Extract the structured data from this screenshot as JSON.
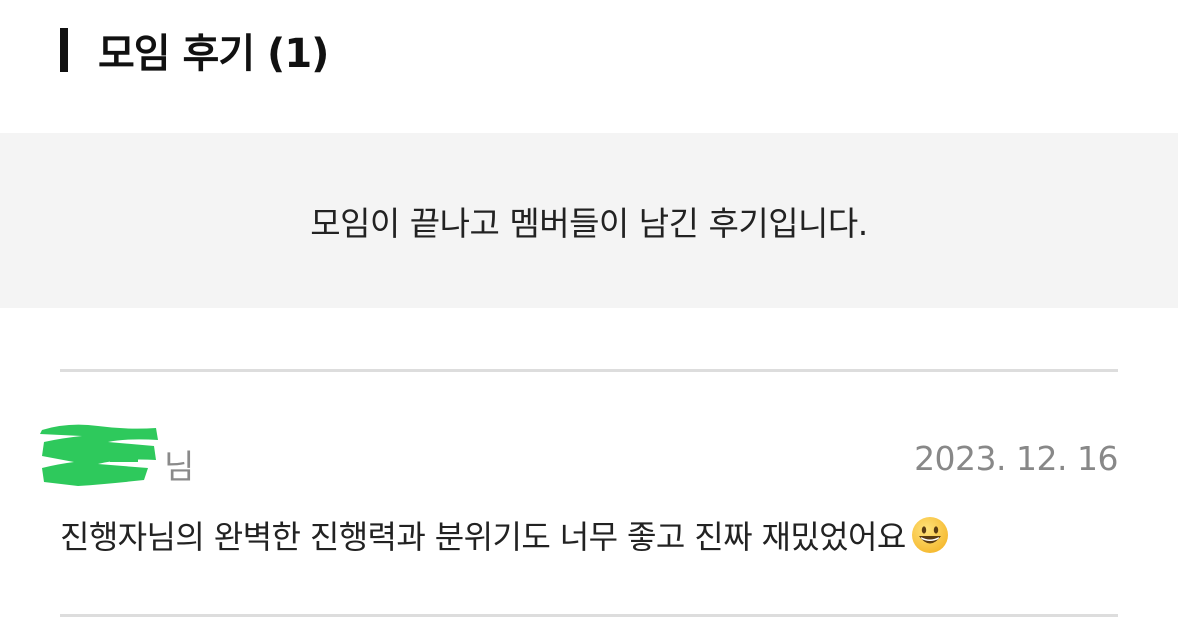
{
  "header": {
    "title": "모임 후기 (1)"
  },
  "notice": {
    "text": "모임이 끝나고 멤버들이 남긴 후기입니다."
  },
  "reviews": [
    {
      "author_suffix": "님",
      "date": "2023. 12. 16",
      "text": "진행자님의 완벽한 진행력과 분위기도 너무 좋고 진짜 재밌었어요",
      "emoji": "smiling-face-icon"
    }
  ],
  "colors": {
    "redaction": "#2ec95c",
    "notice_bg": "#f4f4f4",
    "divider": "#dddddd",
    "muted_text": "#888888"
  }
}
